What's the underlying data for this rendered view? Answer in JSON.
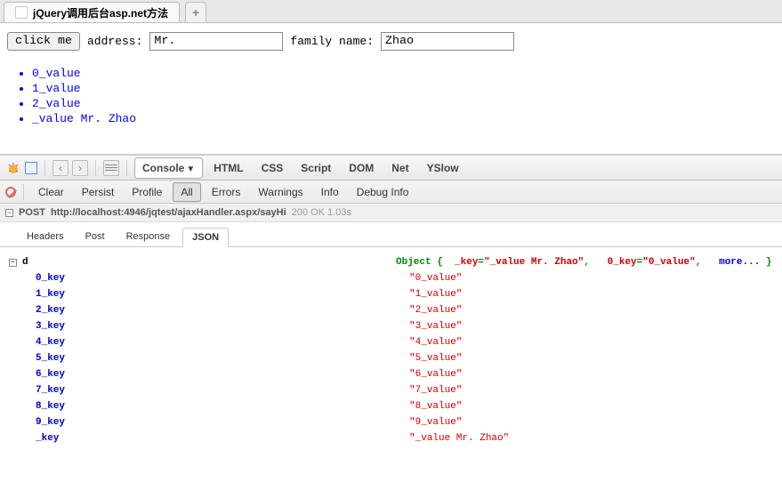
{
  "browser": {
    "tab_title": "jQuery调用后台asp.net方法",
    "newtab_label": "+"
  },
  "page": {
    "click_btn": "click me",
    "address_label": "address:",
    "address_value": "Mr.",
    "family_label": "family name:",
    "family_value": "Zhao",
    "list": [
      "0_value",
      "1_value",
      "2_value",
      "_value Mr. Zhao"
    ]
  },
  "devtools": {
    "panels": [
      "Console",
      "HTML",
      "CSS",
      "Script",
      "DOM",
      "Net",
      "YSlow"
    ],
    "active_panel_index": 0,
    "sub_buttons": [
      "Clear",
      "Persist",
      "Profile",
      "All",
      "Errors",
      "Warnings",
      "Info",
      "Debug Info"
    ],
    "sub_active_index": 3,
    "request": {
      "method": "POST",
      "url": "http://localhost:4946/jqtest/ajaxHandler.aspx/sayHi",
      "status": "200 OK 1.03s"
    },
    "resp_tabs": [
      "Headers",
      "Post",
      "Response",
      "JSON"
    ],
    "resp_active_index": 3,
    "json": {
      "root": "d",
      "summary_prefix": "Object {",
      "summary_k1": "_key",
      "summary_v1": "\"_value Mr. Zhao\"",
      "summary_k2": "0_key",
      "summary_v2": "\"0_value\"",
      "more_label": "more...",
      "rows": [
        {
          "k": "0_key",
          "v": "\"0_value\""
        },
        {
          "k": "1_key",
          "v": "\"1_value\""
        },
        {
          "k": "2_key",
          "v": "\"2_value\""
        },
        {
          "k": "3_key",
          "v": "\"3_value\""
        },
        {
          "k": "4_key",
          "v": "\"4_value\""
        },
        {
          "k": "5_key",
          "v": "\"5_value\""
        },
        {
          "k": "6_key",
          "v": "\"6_value\""
        },
        {
          "k": "7_key",
          "v": "\"7_value\""
        },
        {
          "k": "8_key",
          "v": "\"8_value\""
        },
        {
          "k": "9_key",
          "v": "\"9_value\""
        },
        {
          "k": "_key",
          "v": "\"_value Mr. Zhao\""
        }
      ]
    }
  }
}
